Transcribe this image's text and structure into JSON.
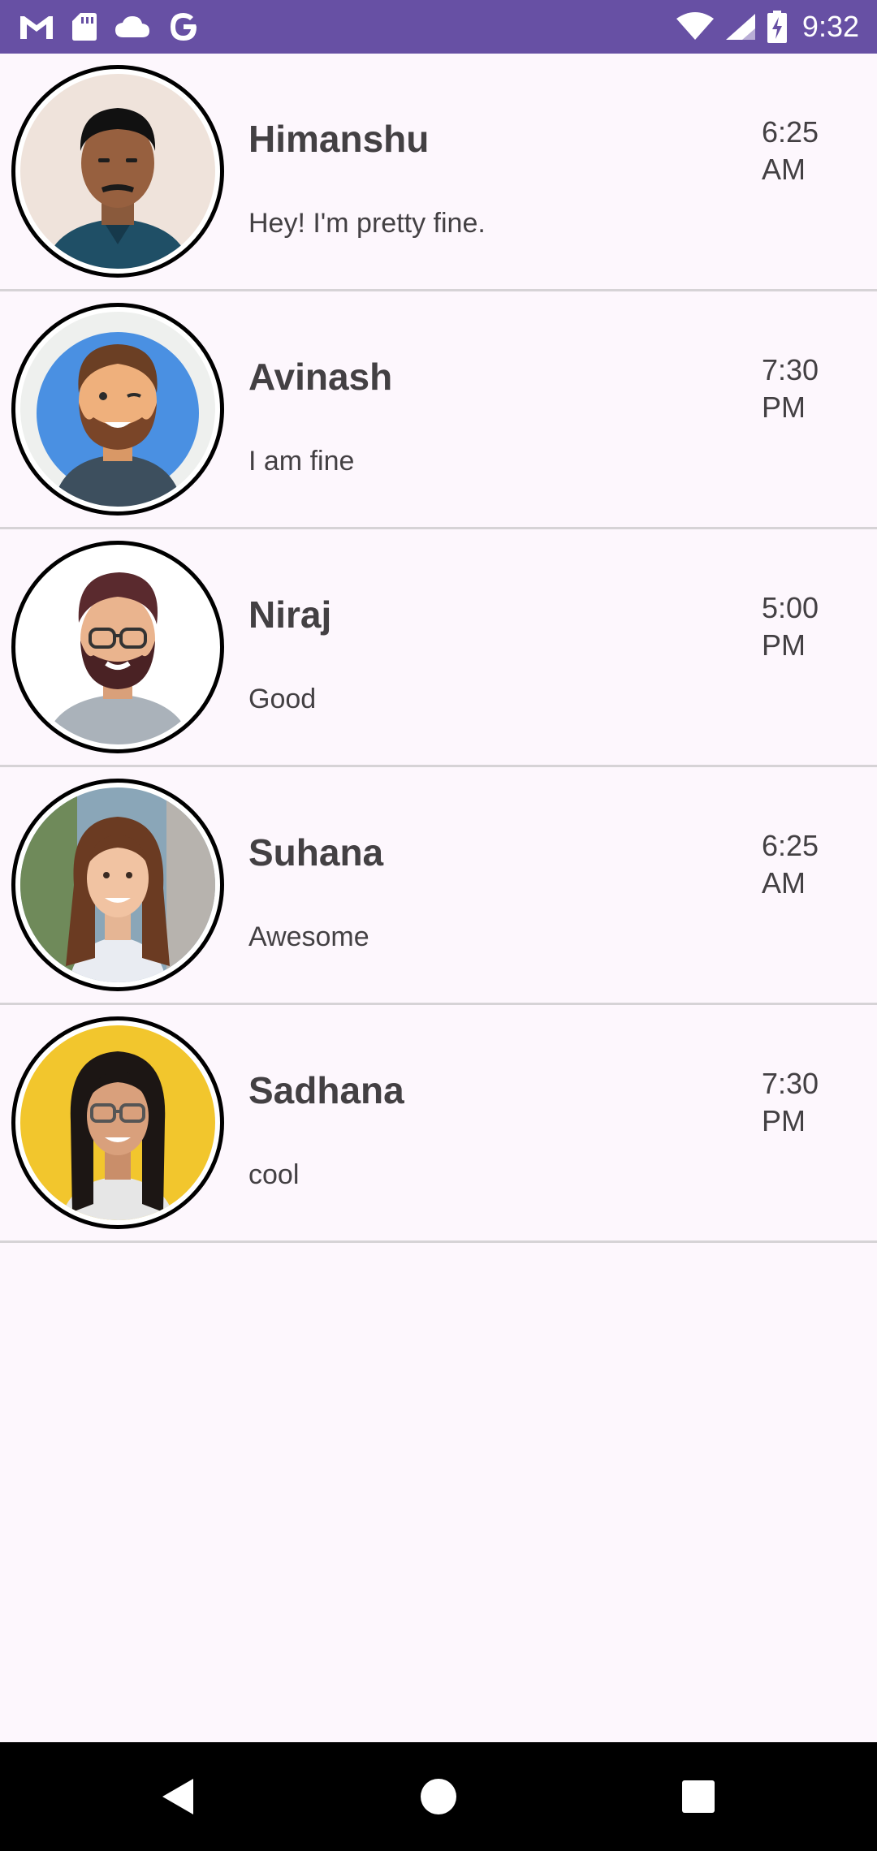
{
  "status_bar": {
    "time": "9:32",
    "left_icons": [
      "gmail-icon",
      "sd-card-icon",
      "cloud-icon",
      "google-icon"
    ],
    "right_icons": [
      "wifi-icon",
      "signal-icon",
      "battery-charging-icon"
    ],
    "background": "#6750a4"
  },
  "chats": [
    {
      "name": "Himanshu",
      "message": "Hey! I'm pretty fine.",
      "time_line1": "6:25",
      "time_line2": "AM",
      "avatar": "photo-avatar-man"
    },
    {
      "name": "Avinash",
      "message": "I am fine",
      "time_line1": "7:30",
      "time_line2": "PM",
      "avatar": "cartoon-avatar-bearded-man"
    },
    {
      "name": "Niraj",
      "message": "Good",
      "time_line1": "5:00",
      "time_line2": "PM",
      "avatar": "cartoon-avatar-glasses-man"
    },
    {
      "name": "Suhana",
      "message": "Awesome",
      "time_line1": "6:25",
      "time_line2": "AM",
      "avatar": "photo-avatar-woman"
    },
    {
      "name": "Sadhana",
      "message": "cool",
      "time_line1": "7:30",
      "time_line2": "PM",
      "avatar": "photo-avatar-woman-glasses"
    }
  ],
  "nav_bar": {
    "buttons": [
      "back-icon",
      "home-icon",
      "recents-icon"
    ]
  }
}
